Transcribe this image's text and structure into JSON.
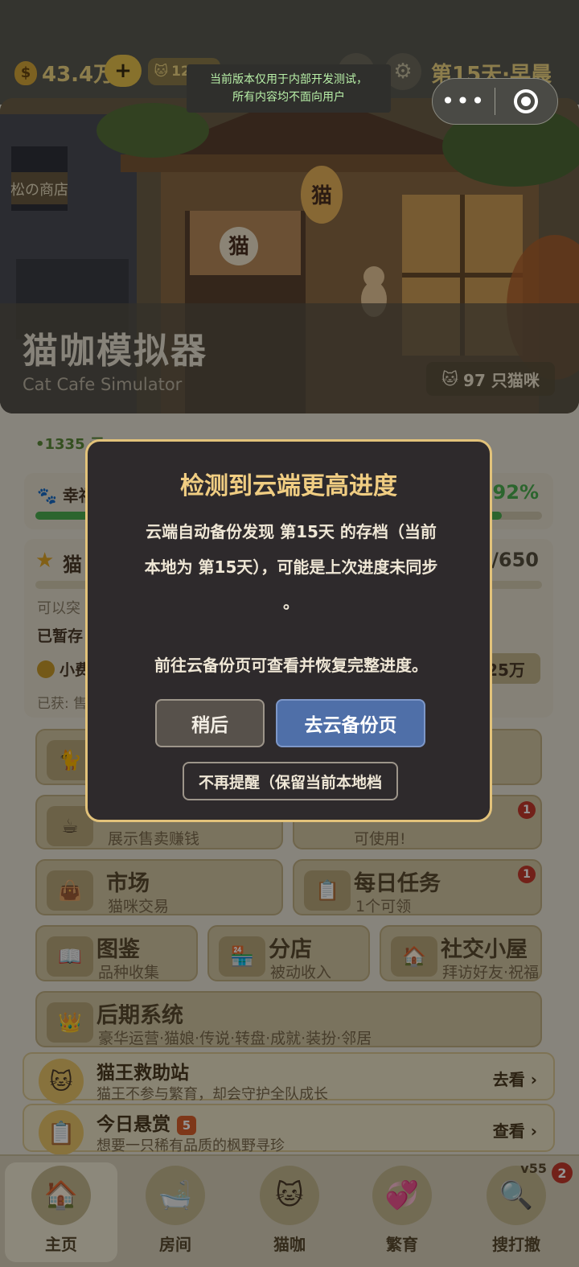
{
  "header": {
    "coins": "43.4万",
    "coin_icon": "$",
    "plus_label": "+",
    "cat_count_label": "12/16",
    "day_label": "第15天·早晨",
    "dev_notice_line1": "当前版本仅用于内部开发测试，",
    "dev_notice_line2": "所有内容均不面向用户"
  },
  "capsule": {
    "more": "•••",
    "close_icon": "target-icon"
  },
  "banner": {
    "lantern_text": "猫",
    "curtain_text": "猫",
    "shop_sign": "松の商店",
    "title": "猫咖模拟器",
    "subtitle": "Cat Cafe Simulator",
    "cat_count": "97 只猫咪"
  },
  "ticker": "•1335 元…",
  "happiness": {
    "label": "🐾 幸福",
    "percent_text": "92%",
    "percent": 92
  },
  "level": {
    "name": "猫",
    "xp": "0/650",
    "line1": "可以突",
    "line2": "已暂存",
    "coin_row": "小费",
    "price": "25万",
    "line4": "已获: 售"
  },
  "tiles": {
    "cafe_top": {
      "title": "",
      "sub": ""
    },
    "exhibit": {
      "title": "",
      "sub": "展示售卖赚钱",
      "icon": "cat-cup-icon"
    },
    "usable": {
      "title": "",
      "sub": "可使用!",
      "badge": "1"
    },
    "market": {
      "title": "市场",
      "sub": "猫咪交易",
      "icon": "bag-icon"
    },
    "daily": {
      "title": "每日任务",
      "sub": "1个可领",
      "badge": "1",
      "icon": "clipboard-icon"
    },
    "guide": {
      "title": "图鉴",
      "sub": "品种收集",
      "icon": "book-icon"
    },
    "branch": {
      "title": "分店",
      "sub": "被动收入",
      "icon": "shop-icon"
    },
    "social": {
      "title": "社交小屋",
      "sub": "拜访好友·祝福",
      "icon": "house-icon"
    },
    "late": {
      "title": "后期系统",
      "sub": "豪华运营·猫娘·传说·转盘·成就·装扮·邻居",
      "icon": "crown-icon"
    }
  },
  "rescue": {
    "title": "猫王救助站",
    "sub": "猫王不参与繁育，却会守护全队成长",
    "action": "去看 ›"
  },
  "bounty": {
    "title": "今日悬赏",
    "count": "5",
    "sub": "想要一只稀有品质的枫野寻珍",
    "action": "查看 ›"
  },
  "tabs": [
    {
      "label": "主页",
      "icon": "home-icon"
    },
    {
      "label": "房间",
      "icon": "room-icon"
    },
    {
      "label": "猫咖",
      "icon": "cat-icon"
    },
    {
      "label": "繁育",
      "icon": "breed-icon"
    },
    {
      "label": "搜打撤",
      "icon": "search-icon"
    }
  ],
  "version": "v55",
  "version_badge": "2",
  "modal": {
    "title": "检测到云端更高进度",
    "body_line1": "云端自动备份发现 第15天 的存档（当前",
    "body_line2": "本地为 第15天），可能是上次进度未同步",
    "body_line3": "。",
    "body_line4": "前往云备份页可查看并恢复完整进度。",
    "later": "稍后",
    "go": "去云备份页",
    "never": "不再提醒（保留当前本地档"
  },
  "colors": {
    "accent_gold": "#f0cd82",
    "modal_bg": "#2e2a2c",
    "primary_blue": "#4f6fa8",
    "progress_green": "#4caf50",
    "badge_red": "#c43a2c"
  }
}
